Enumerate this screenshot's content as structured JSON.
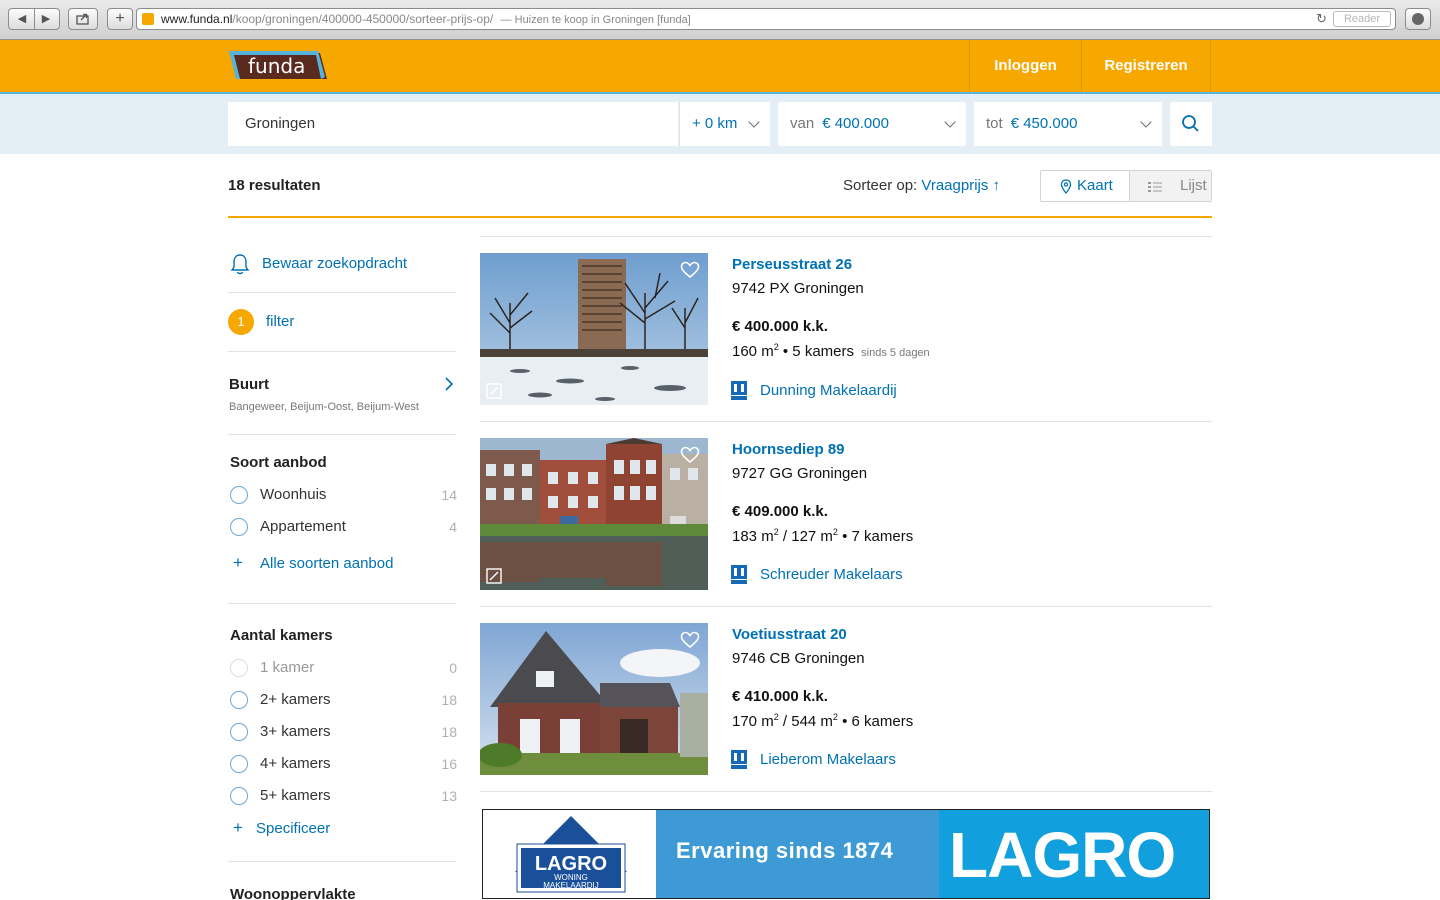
{
  "browser": {
    "url_host": "www.funda.nl",
    "url_path": "/koop/groningen/400000-450000/sorteer-prijs-op/",
    "title": "— Huizen te koop in Groningen [funda]",
    "reader_label": "Reader"
  },
  "header": {
    "logo_text": "funda",
    "login_label": "Inloggen",
    "register_label": "Registreren"
  },
  "search": {
    "location": "Groningen",
    "radius": "+ 0 km",
    "price_from_prefix": "van",
    "price_from": "€ 400.000",
    "price_to_prefix": "tot",
    "price_to": "€ 450.000"
  },
  "results": {
    "count_label": "18 resultaten",
    "sort_prefix": "Sorteer op:",
    "sort_value": "Vraagprijs",
    "view_map": "Kaart",
    "view_list": "Lijst"
  },
  "sidebar": {
    "save_search": "Bewaar zoekopdracht",
    "filter_count": "1",
    "filter_label": "filter",
    "buurt_title": "Buurt",
    "buurt_sub": "Bangeweer, Beijum-Oost, Beijum-West",
    "soort_title": "Soort aanbod",
    "soort_options": [
      {
        "label": "Woonhuis",
        "count": "14"
      },
      {
        "label": "Appartement",
        "count": "4"
      }
    ],
    "soort_more": "Alle soorten aanbod",
    "kamers_title": "Aantal kamers",
    "kamers_options": [
      {
        "label": "1 kamer",
        "count": "0"
      },
      {
        "label": "2+ kamers",
        "count": "18"
      },
      {
        "label": "3+ kamers",
        "count": "18"
      },
      {
        "label": "4+ kamers",
        "count": "16"
      },
      {
        "label": "5+ kamers",
        "count": "13"
      }
    ],
    "kamers_more": "Specificeer",
    "opp_title": "Woonoppervlakte"
  },
  "listings": [
    {
      "street": "Perseusstraat 26",
      "postal": "9742 PX Groningen",
      "price": "€ 400.000 k.k.",
      "area": "160 m",
      "plot": "",
      "rooms": "• 5 kamers",
      "since": "sinds 5 dagen",
      "agent": "Dunning Makelaardij"
    },
    {
      "street": "Hoornsediep 89",
      "postal": "9727 GG Groningen",
      "price": "€ 409.000 k.k.",
      "area": "183 m",
      "plot": "/ 127 m",
      "rooms": "• 7 kamers",
      "since": "",
      "agent": "Schreuder Makelaars"
    },
    {
      "street": "Voetiusstraat 20",
      "postal": "9746 CB Groningen",
      "price": "€ 410.000 k.k.",
      "area": "170 m",
      "plot": "/ 544 m",
      "rooms": "• 6 kamers",
      "since": "",
      "agent": "Lieberom Makelaars"
    }
  ],
  "banner": {
    "logo_small": "LAGRO",
    "logo_sub1": "WONING",
    "logo_sub2": "MAKELAARDIJ",
    "slogan": "Ervaring sinds 1874",
    "logo_big": "LAGRO"
  },
  "colors": {
    "brand_orange": "#f7a800",
    "link_blue": "#0071b3",
    "search_band": "#e4eef5"
  },
  "icons": {
    "bell": "bell-icon",
    "chevron": "chevron-down-icon",
    "search": "search-icon",
    "heart": "heart-icon",
    "map_pin": "map-pin-icon",
    "list": "list-icon"
  }
}
